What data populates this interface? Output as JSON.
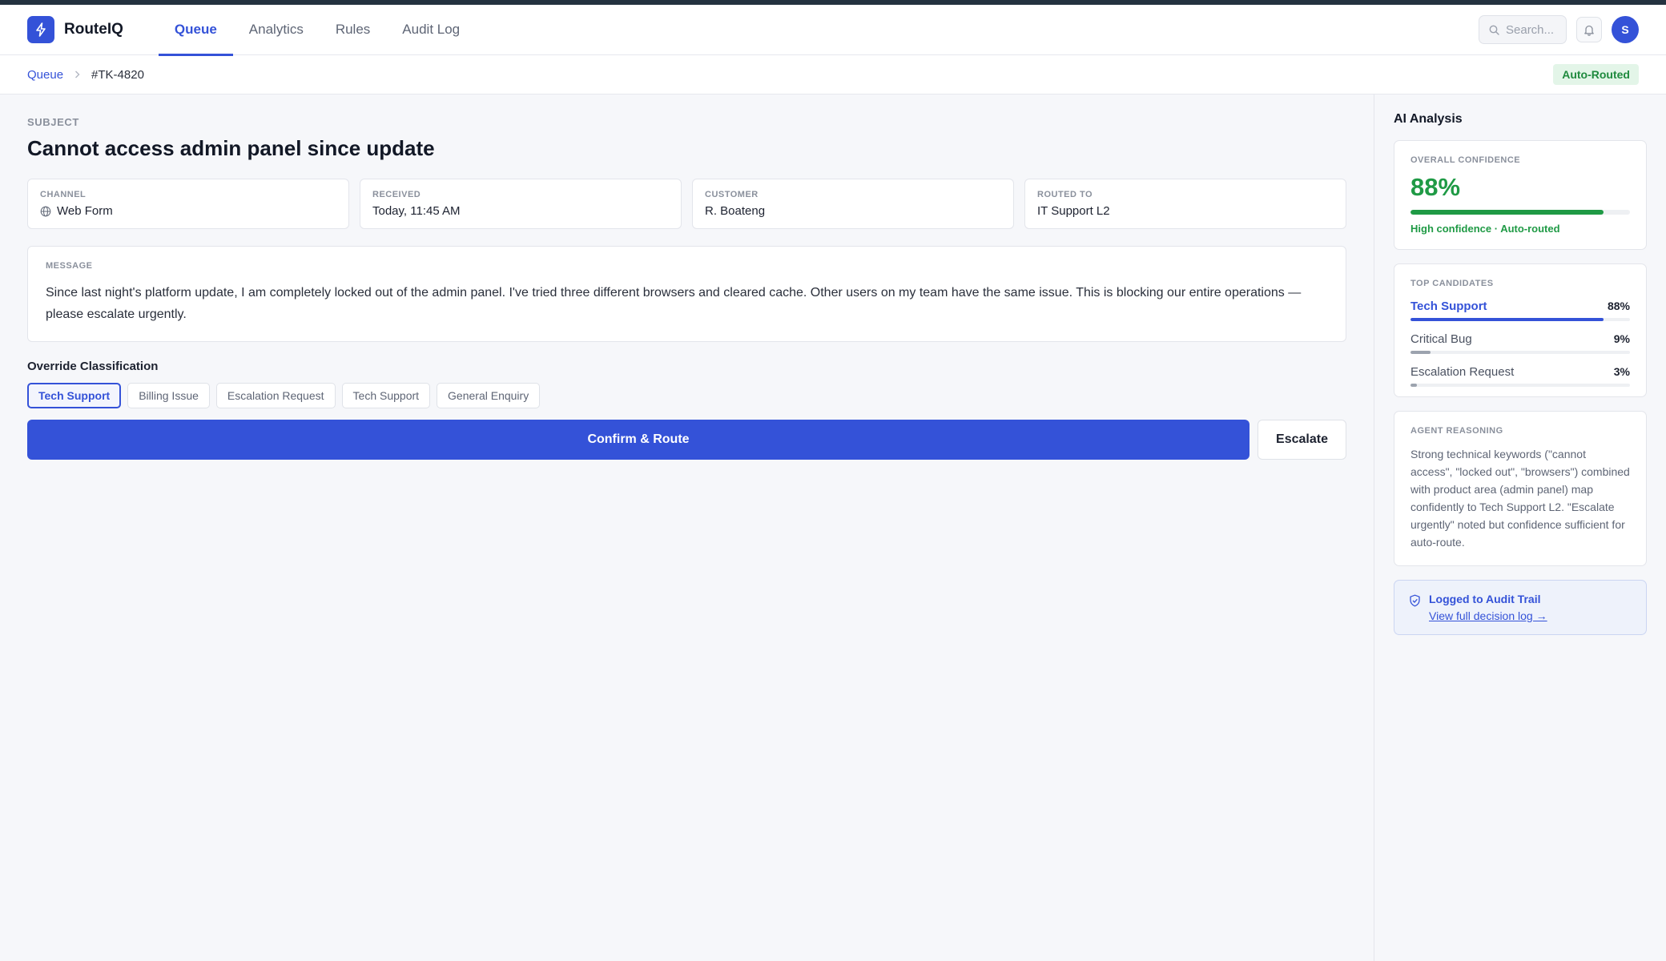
{
  "app": {
    "name": "RouteIQ"
  },
  "nav": {
    "tabs": [
      {
        "label": "Queue"
      },
      {
        "label": "Analytics"
      },
      {
        "label": "Rules"
      },
      {
        "label": "Audit Log"
      }
    ]
  },
  "search": {
    "placeholder": "Search..."
  },
  "user": {
    "initial": "S"
  },
  "breadcrumb": {
    "root": "Queue",
    "current": "#TK-4820"
  },
  "status_badge": "Auto-Routed",
  "ticket": {
    "subject_label": "SUBJECT",
    "subject": "Cannot access admin panel since update",
    "meta": [
      {
        "label": "CHANNEL",
        "value": "Web Form"
      },
      {
        "label": "RECEIVED",
        "value": "Today, 11:45 AM"
      },
      {
        "label": "CUSTOMER",
        "value": "R. Boateng"
      },
      {
        "label": "ROUTED TO",
        "value": "IT Support L2"
      }
    ],
    "message_label": "MESSAGE",
    "message": "Since last night's platform update, I am completely locked out of the admin panel. I've tried three different browsers and cleared cache. Other users on my team have the same issue. This is blocking our entire operations — please escalate urgently."
  },
  "override": {
    "title": "Override Classification",
    "options": [
      "Tech Support",
      "Billing Issue",
      "Escalation Request",
      "Tech Support",
      "General Enquiry"
    ],
    "selected_index": 0
  },
  "actions": {
    "confirm": "Confirm & Route",
    "escalate": "Escalate"
  },
  "analysis": {
    "title": "AI Analysis",
    "confidence_label": "OVERALL CONFIDENCE",
    "confidence": "88%",
    "confidence_fraction": 0.88,
    "confidence_note": "High confidence · Auto-routed",
    "candidates_label": "TOP CANDIDATES",
    "candidates": [
      {
        "name": "Tech Support",
        "pct": "88%",
        "fraction": 0.88
      },
      {
        "name": "Critical Bug",
        "pct": "9%",
        "fraction": 0.09
      },
      {
        "name": "Escalation Request",
        "pct": "3%",
        "fraction": 0.03
      }
    ],
    "reasoning_label": "AGENT REASONING",
    "reasoning": "Strong technical keywords (\"cannot access\", \"locked out\", \"browsers\") combined with product area (admin panel) map confidently to Tech Support L2. \"Escalate urgently\" noted but confidence sufficient for auto-route.",
    "audit_title": "Logged to Audit Trail",
    "audit_link": "View full decision log →"
  },
  "colors": {
    "accent": "#3452d8",
    "success": "#1f9a45",
    "bar_secondary": "#9ca3ae",
    "bar_track": "#eef0f3"
  }
}
